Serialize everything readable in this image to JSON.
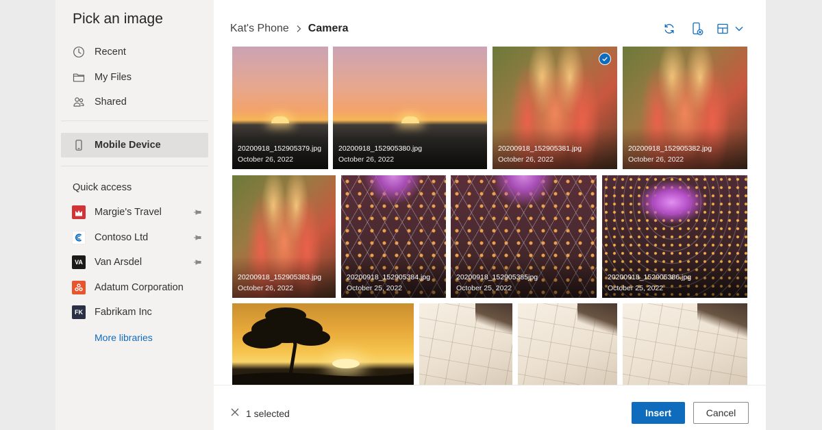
{
  "sidebar": {
    "title": "Pick an image",
    "nav": [
      {
        "label": "Recent",
        "icon": "clock-icon"
      },
      {
        "label": "My Files",
        "icon": "folder-icon"
      },
      {
        "label": "Shared",
        "icon": "people-icon"
      }
    ],
    "device": {
      "label": "Mobile Device",
      "icon": "phone-icon",
      "selected": true
    },
    "quick_access_title": "Quick access",
    "libraries": [
      {
        "label": "Margie's Travel",
        "badge": "",
        "color": "#d13438",
        "pinned": true
      },
      {
        "label": "Contoso Ltd",
        "badge": "",
        "color": "#ffffff",
        "pinned": true
      },
      {
        "label": "Van Arsdel",
        "badge": "VA",
        "color": "#1b1a19",
        "pinned": true
      },
      {
        "label": "Adatum Corporation",
        "badge": "",
        "color": "#e8552d",
        "pinned": false
      },
      {
        "label": "Fabrikam Inc",
        "badge": "FK",
        "color": "#2b2f45",
        "pinned": false
      }
    ],
    "more_libraries": "More libraries"
  },
  "breadcrumb": {
    "parent": "Kat's Phone",
    "current": "Camera"
  },
  "toolbar": {
    "icons": [
      "refresh-icon",
      "phone-sync-icon",
      "layout-icon",
      "chevron-down-icon"
    ]
  },
  "photos": [
    {
      "name": "20200918_152905379.jpg",
      "date": "October 26, 2022",
      "kind": "sunset",
      "selected": false
    },
    {
      "name": "20200918_152905380.jpg",
      "date": "October 26, 2022",
      "kind": "sunset",
      "selected": false
    },
    {
      "name": "20200918_152905381.jpg",
      "date": "October 26, 2022",
      "kind": "succulent",
      "selected": true
    },
    {
      "name": "20200918_152905382.jpg",
      "date": "October 26, 2022",
      "kind": "succulent",
      "selected": false
    },
    {
      "name": "20200918_152905383.jpg",
      "date": "October 26, 2022",
      "kind": "succulent",
      "selected": false
    },
    {
      "name": "20200918_152905384.jpg",
      "date": "October 25, 2022",
      "kind": "dome",
      "selected": false
    },
    {
      "name": "20200918_152905385jpg",
      "date": "October 25, 2022",
      "kind": "dome",
      "selected": false
    },
    {
      "name": "20200918_152905386.jpg",
      "date": "October 25, 2022",
      "kind": "dome2",
      "selected": false
    },
    {
      "name": "",
      "date": "",
      "kind": "savanna",
      "selected": false
    },
    {
      "name": "",
      "date": "",
      "kind": "building",
      "selected": false
    },
    {
      "name": "",
      "date": "",
      "kind": "building",
      "selected": false
    },
    {
      "name": "",
      "date": "",
      "kind": "building",
      "selected": false
    }
  ],
  "footer": {
    "selection": "1 selected",
    "insert": "Insert",
    "cancel": "Cancel"
  },
  "colors": {
    "accent": "#0f6cbd",
    "sidebar_bg": "#f3f2f1",
    "selected_nav": "#e1dfdd"
  }
}
